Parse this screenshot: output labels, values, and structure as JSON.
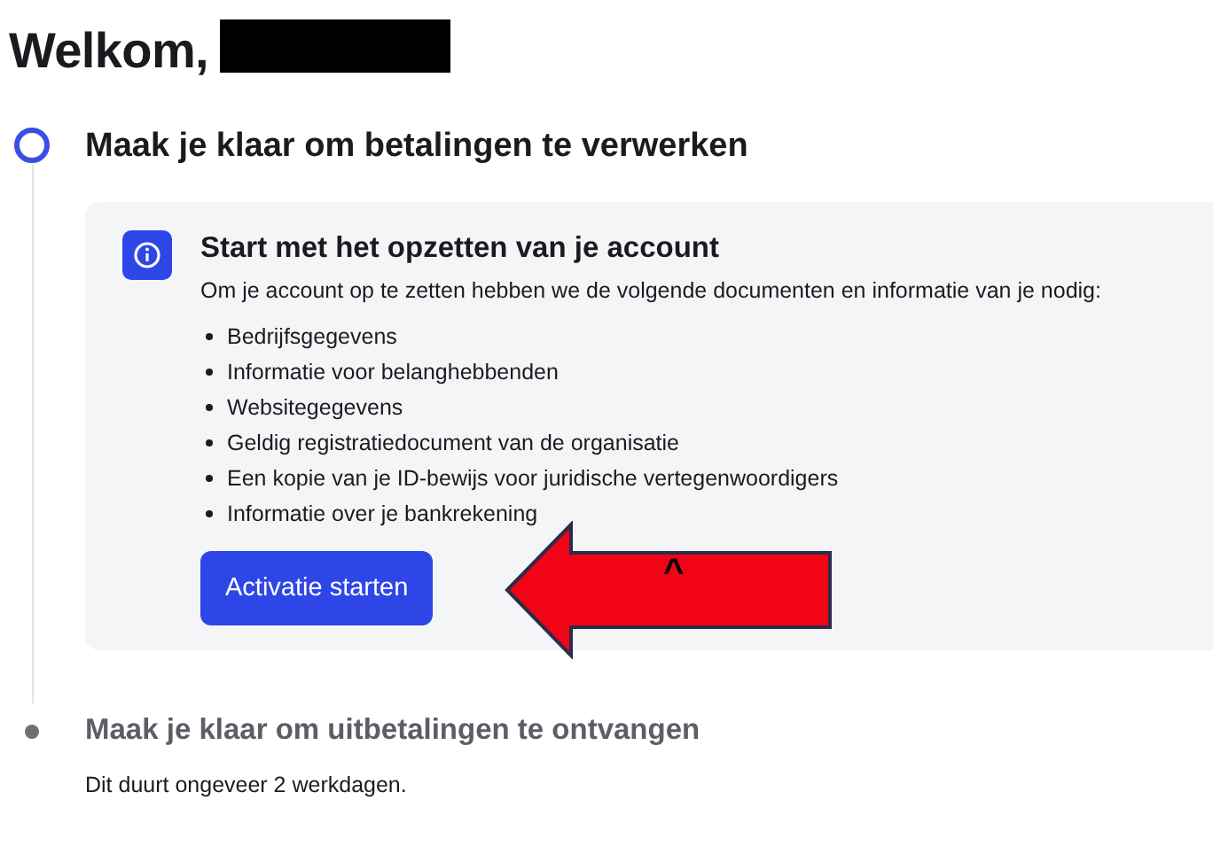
{
  "greeting": "Welkom,",
  "redacted": true,
  "steps": [
    {
      "kind": "current",
      "title": "Maak je klaar om betalingen te verwerken",
      "card": {
        "title": "Start met het opzetten van je account",
        "description": "Om je account op te zetten hebben we de volgende documenten en informatie van je nodig:",
        "items": [
          "Bedrijfsgegevens",
          "Informatie voor belanghebbenden",
          "Websitegegevens",
          "Geldig registratiedocument van de organisatie",
          "Een kopie van je ID-bewijs voor juridische vertegenwoordigers",
          "Informatie over je bankrekening"
        ],
        "button": "Activatie starten"
      }
    },
    {
      "kind": "upcoming",
      "title": "Maak je klaar om uitbetalingen te ontvangen",
      "description": "Dit duurt ongeveer 2 werkdagen."
    }
  ],
  "annotation": {
    "label": "^"
  }
}
